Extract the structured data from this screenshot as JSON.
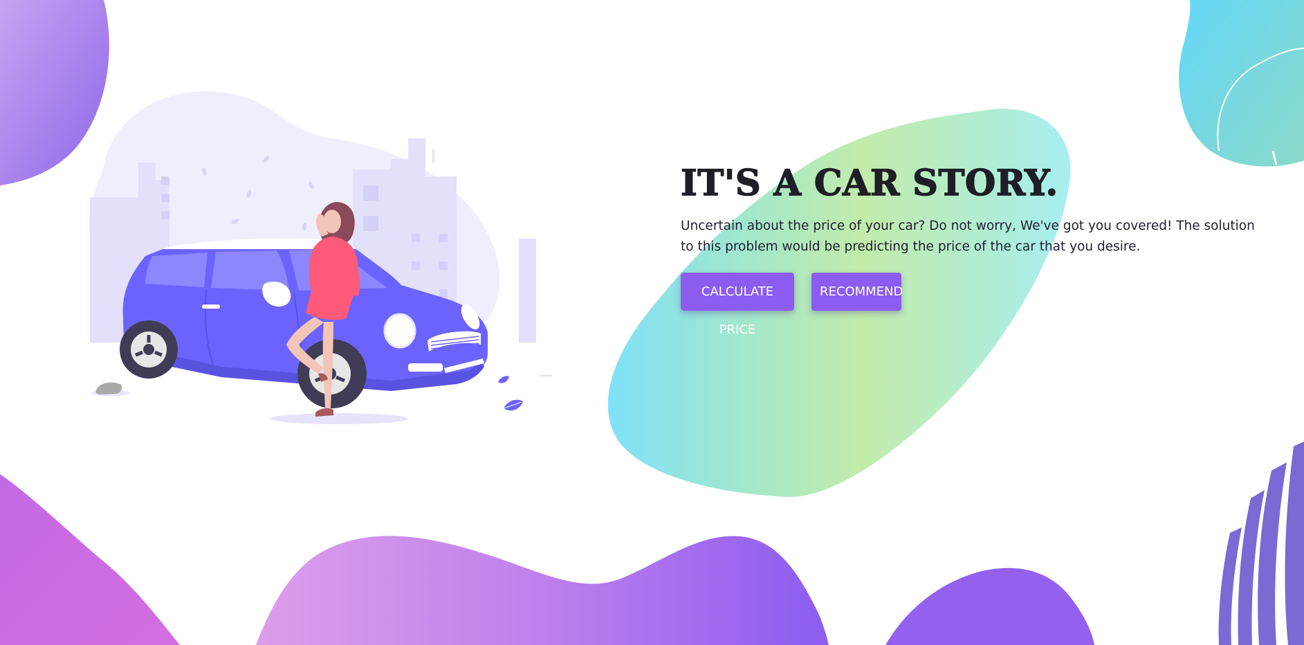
{
  "hero": {
    "title": "IT'S A CAR STORY.",
    "description": "Uncertain about the price of your car? Do not worry, We've got you covered! The solution to this problem would be predicting the price of the car that you desire.",
    "buttons": {
      "calculate_label": "CALCULATE PRICE",
      "recommend_label": "RECOMMEND"
    }
  },
  "colors": {
    "button": "#8c5cf0",
    "title": "#1e1e26",
    "car_body": "#6c63ff",
    "dress": "#ff5a7a",
    "bottom_wave_start": "#dba0ea",
    "bottom_wave_end": "#8c5cf0",
    "center_blob_start": "#7fe0f5",
    "center_blob_mid": "#c0ecaa",
    "top_right_blob": "#6cd6f2"
  },
  "illustration": {
    "name": "woman-leaning-on-car",
    "icons": [
      "city-skyline",
      "car",
      "woman",
      "leaf-icon",
      "rock"
    ]
  }
}
